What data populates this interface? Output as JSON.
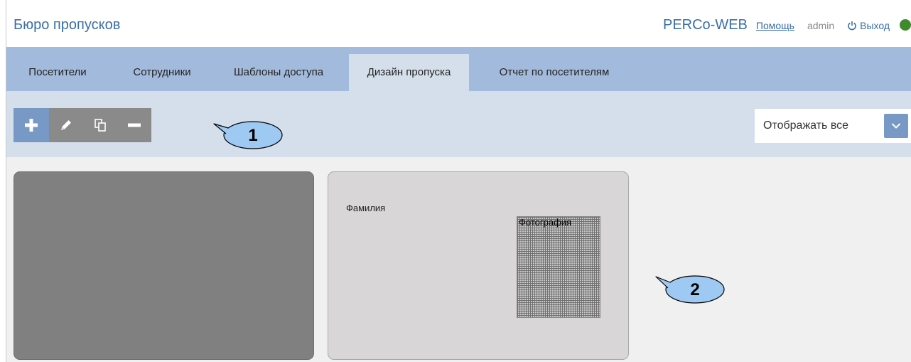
{
  "header": {
    "title": "Бюро пропусков",
    "brand": "PERCo-WEB",
    "help": "Помощь",
    "user": "admin",
    "logout": "Выход",
    "status_color": "#3f8a2a"
  },
  "tabs": [
    {
      "label": "Посетители",
      "active": false
    },
    {
      "label": "Сотрудники",
      "active": false
    },
    {
      "label": "Шаблоны доступа",
      "active": false
    },
    {
      "label": "Дизайн пропуска",
      "active": true
    },
    {
      "label": "Отчет по посетителям",
      "active": false
    }
  ],
  "toolbar": {
    "buttons": [
      "plus-icon",
      "pencil-icon",
      "copy-icon",
      "minus-icon"
    ],
    "filter": {
      "selected": "Отображать все"
    }
  },
  "callouts": [
    "1",
    "2"
  ],
  "cards": [
    {
      "color": "#808080"
    },
    {
      "color": "#d8d6d6",
      "surname_field": "Фамилия",
      "photo_field": "Фотография"
    }
  ]
}
